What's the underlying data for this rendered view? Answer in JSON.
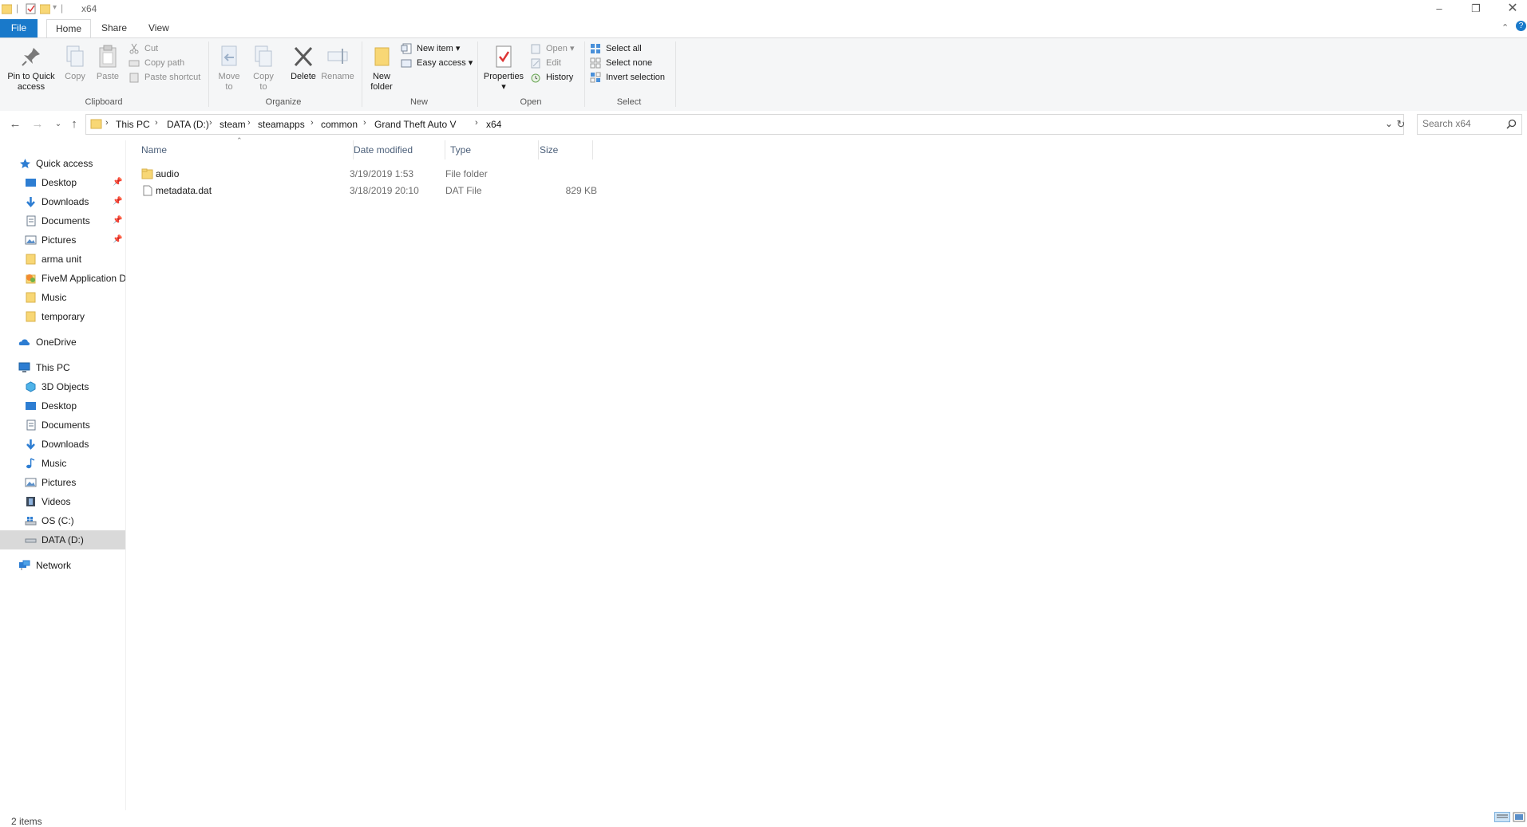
{
  "window": {
    "title": "x64"
  },
  "tabs": {
    "file": "File",
    "home": "Home",
    "share": "Share",
    "view": "View"
  },
  "ribbon": {
    "clipboard": {
      "label": "Clipboard",
      "pin": "Pin to Quick access",
      "copy": "Copy",
      "paste": "Paste",
      "cut": "Cut",
      "copy_path": "Copy path",
      "paste_shortcut": "Paste shortcut"
    },
    "organize": {
      "label": "Organize",
      "move_to": "Move to",
      "copy_to": "Copy to",
      "delete": "Delete",
      "rename": "Rename"
    },
    "new": {
      "label": "New",
      "new_folder": "New folder",
      "new_item": "New item",
      "easy_access": "Easy access"
    },
    "open": {
      "label": "Open",
      "properties": "Properties",
      "open": "Open",
      "edit": "Edit",
      "history": "History"
    },
    "select": {
      "label": "Select",
      "select_all": "Select all",
      "select_none": "Select none",
      "invert": "Invert selection"
    }
  },
  "address": {
    "crumbs": [
      "This PC",
      "DATA (D:)",
      "steam",
      "steamapps",
      "common",
      "Grand Theft Auto V",
      "x64"
    ],
    "search_placeholder": "Search x64"
  },
  "nav": {
    "quick_access": "Quick access",
    "quick_items": [
      "Desktop",
      "Downloads",
      "Documents",
      "Pictures",
      "arma unit",
      "FiveM Application Data",
      "Music",
      "temporary"
    ],
    "onedrive": "OneDrive",
    "this_pc": "This PC",
    "pc_items": [
      "3D Objects",
      "Desktop",
      "Documents",
      "Downloads",
      "Music",
      "Pictures",
      "Videos",
      "OS (C:)",
      "DATA (D:)"
    ],
    "network": "Network"
  },
  "columns": {
    "name": "Name",
    "date": "Date modified",
    "type": "Type",
    "size": "Size"
  },
  "files": [
    {
      "name": "audio",
      "date": "3/19/2019 1:53",
      "type": "File folder",
      "size": ""
    },
    {
      "name": "metadata.dat",
      "date": "3/18/2019 20:10",
      "type": "DAT File",
      "size": "829 KB"
    }
  ],
  "status": {
    "items": "2 items"
  },
  "colors": {
    "accent": "#1979ca",
    "folder": "#f8d775",
    "selected": "#d9d9d9"
  }
}
